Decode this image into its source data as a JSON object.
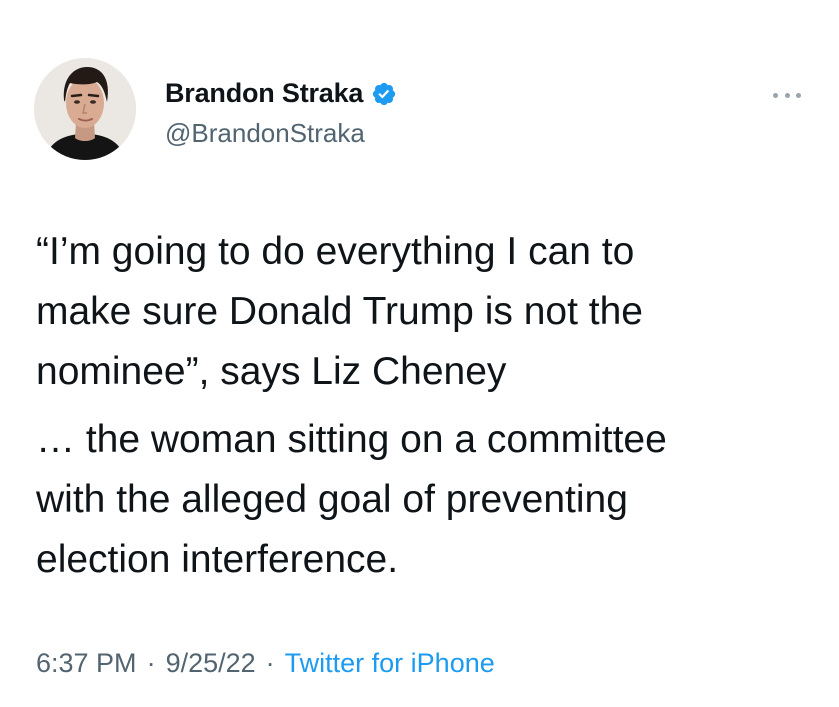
{
  "author": {
    "display_name": "Brandon Straka",
    "handle": "@BrandonStraka",
    "verified": true,
    "verified_icon": "verified-badge-icon",
    "avatar": "profile-photo"
  },
  "more_icon": "more-dots-icon",
  "tweet": {
    "paragraph1": "“I’m going to do everything I can to\nmake sure Donald Trump is not the\nnominee”, says Liz Cheney",
    "paragraph2": "… the woman sitting on a committee\nwith the alleged goal of preventing\nelection interference."
  },
  "meta": {
    "time": "6:37 PM",
    "separator": "·",
    "date": "9/25/22",
    "source": "Twitter for iPhone"
  },
  "colors": {
    "text": "#0f1419",
    "secondary": "#536471",
    "accent": "#1d9bf0"
  }
}
